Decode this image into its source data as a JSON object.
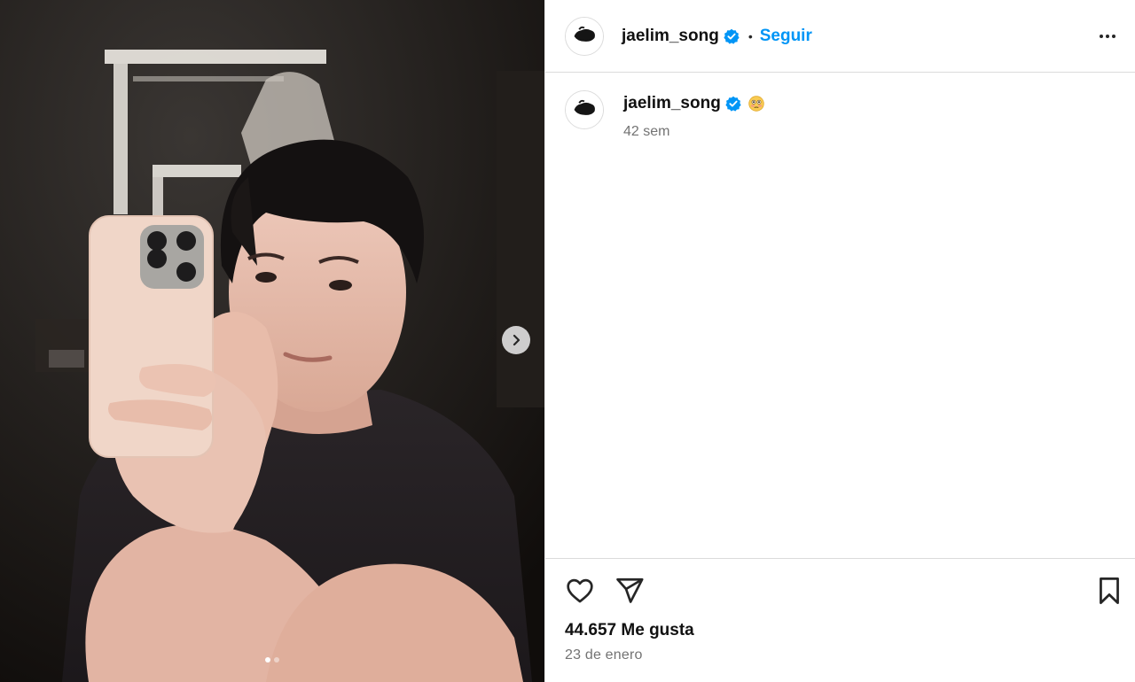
{
  "post": {
    "username": "jaelim_song",
    "verified": true,
    "follow_label": "Seguir",
    "separator": "•",
    "caption_emoji": "😳",
    "time_ago": "42 sem",
    "likes_text": "44.657 Me gusta",
    "date_text": "23 de enero"
  },
  "carousel": {
    "slides": 2,
    "active_index": 0
  },
  "icons": {
    "verified": "verified-badge-icon",
    "like": "heart-icon",
    "share": "paper-plane-icon",
    "save": "bookmark-icon",
    "more": "more-options-icon",
    "next": "chevron-right-icon"
  },
  "colors": {
    "accent": "#0095f6",
    "verified": "#0095f6",
    "secondary_text": "#737373",
    "divider": "#dbdbdb"
  }
}
